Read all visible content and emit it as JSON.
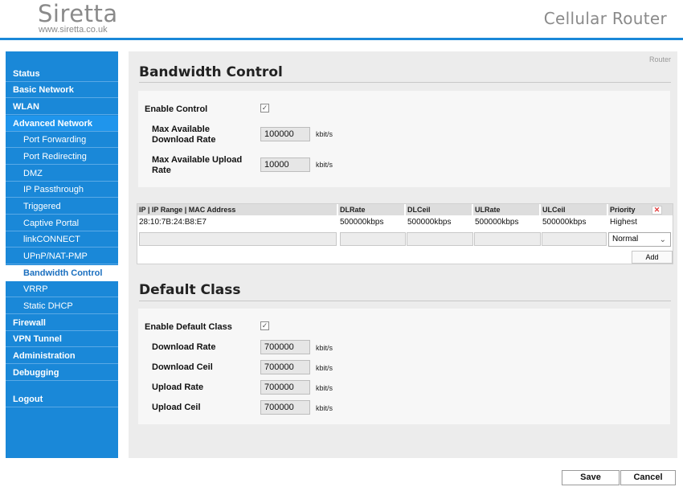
{
  "header": {
    "logo": "Siretta",
    "logo_url": "www.siretta.co.uk",
    "product": "Cellular Router"
  },
  "sidebar": {
    "items": [
      {
        "label": "Status"
      },
      {
        "label": "Basic Network"
      },
      {
        "label": "WLAN"
      },
      {
        "label": "Advanced Network"
      },
      {
        "label": "Port Forwarding"
      },
      {
        "label": "Port Redirecting"
      },
      {
        "label": "DMZ"
      },
      {
        "label": "IP Passthrough"
      },
      {
        "label": "Triggered"
      },
      {
        "label": "Captive Portal"
      },
      {
        "label": "linkCONNECT"
      },
      {
        "label": "UPnP/NAT-PMP"
      },
      {
        "label": "Bandwidth Control"
      },
      {
        "label": "VRRP"
      },
      {
        "label": "Static DHCP"
      },
      {
        "label": "Firewall"
      },
      {
        "label": "VPN Tunnel"
      },
      {
        "label": "Administration"
      },
      {
        "label": "Debugging"
      },
      {
        "label": "Logout"
      }
    ]
  },
  "breadcrumb": "Router",
  "bandwidth": {
    "title": "Bandwidth Control",
    "enable_label": "Enable Control",
    "enable_checked": true,
    "max_down_label": "Max Available Download Rate",
    "max_down_value": "100000",
    "max_up_label": "Max Available Upload Rate",
    "max_up_value": "10000",
    "unit": "kbit/s"
  },
  "rules_table": {
    "headers": [
      "IP | IP Range | MAC Address",
      "DLRate",
      "DLCeil",
      "ULRate",
      "ULCeil",
      "Priority"
    ],
    "rows": [
      [
        "28:10:7B:24:B8:E7",
        "500000kbps",
        "500000kbps",
        "500000kbps",
        "500000kbps",
        "Highest"
      ]
    ],
    "new_priority": "Normal",
    "add_label": "Add"
  },
  "default_class": {
    "title": "Default Class",
    "enable_label": "Enable Default Class",
    "enable_checked": true,
    "download_rate_label": "Download Rate",
    "download_rate_value": "700000",
    "download_ceil_label": "Download Ceil",
    "download_ceil_value": "700000",
    "upload_rate_label": "Upload Rate",
    "upload_rate_value": "700000",
    "upload_ceil_label": "Upload Ceil",
    "upload_ceil_value": "700000",
    "unit": "kbit/s"
  },
  "footer": {
    "save_label": "Save",
    "cancel_label": "Cancel"
  }
}
